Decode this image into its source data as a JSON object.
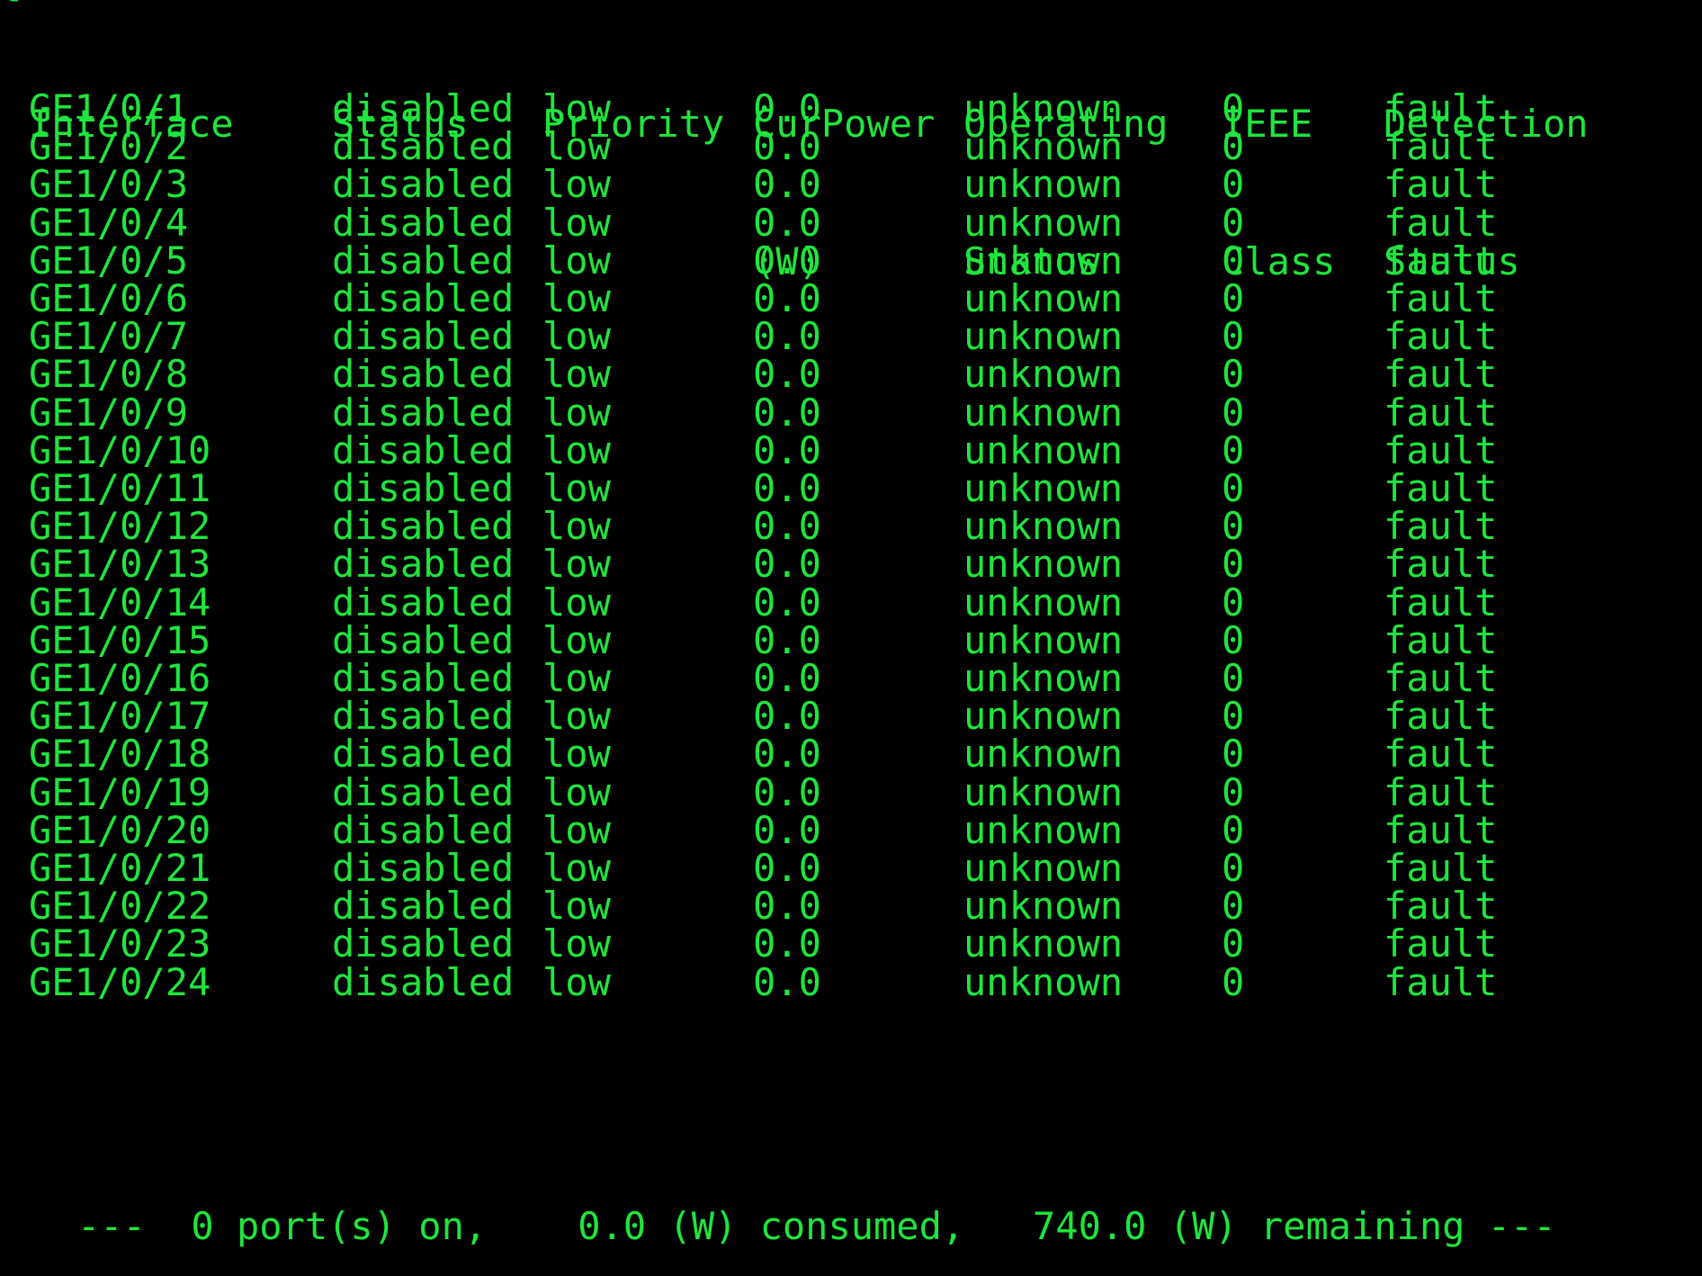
{
  "colors": {
    "background": "#000000",
    "text": "#1ee63c"
  },
  "terminal": {
    "prompt_fragment": "[",
    "headers": {
      "interface": [
        "Interface"
      ],
      "status": [
        "Status"
      ],
      "priority": [
        "Priority"
      ],
      "curpower": [
        "CurPower",
        "(W)"
      ],
      "operating": [
        "Operating",
        "Status"
      ],
      "ieee": [
        "IEEE",
        "Class"
      ],
      "detection": [
        "Detection",
        "Status"
      ]
    },
    "rows": [
      {
        "interface": "GE1/0/1",
        "status": "disabled",
        "priority": "low",
        "curpower": "0.0",
        "operating": "unknown",
        "ieee_class": "0",
        "detection": "fault"
      },
      {
        "interface": "GE1/0/2",
        "status": "disabled",
        "priority": "low",
        "curpower": "0.0",
        "operating": "unknown",
        "ieee_class": "0",
        "detection": "fault"
      },
      {
        "interface": "GE1/0/3",
        "status": "disabled",
        "priority": "low",
        "curpower": "0.0",
        "operating": "unknown",
        "ieee_class": "0",
        "detection": "fault"
      },
      {
        "interface": "GE1/0/4",
        "status": "disabled",
        "priority": "low",
        "curpower": "0.0",
        "operating": "unknown",
        "ieee_class": "0",
        "detection": "fault"
      },
      {
        "interface": "GE1/0/5",
        "status": "disabled",
        "priority": "low",
        "curpower": "0.0",
        "operating": "unknown",
        "ieee_class": "0",
        "detection": "fault"
      },
      {
        "interface": "GE1/0/6",
        "status": "disabled",
        "priority": "low",
        "curpower": "0.0",
        "operating": "unknown",
        "ieee_class": "0",
        "detection": "fault"
      },
      {
        "interface": "GE1/0/7",
        "status": "disabled",
        "priority": "low",
        "curpower": "0.0",
        "operating": "unknown",
        "ieee_class": "0",
        "detection": "fault"
      },
      {
        "interface": "GE1/0/8",
        "status": "disabled",
        "priority": "low",
        "curpower": "0.0",
        "operating": "unknown",
        "ieee_class": "0",
        "detection": "fault"
      },
      {
        "interface": "GE1/0/9",
        "status": "disabled",
        "priority": "low",
        "curpower": "0.0",
        "operating": "unknown",
        "ieee_class": "0",
        "detection": "fault"
      },
      {
        "interface": "GE1/0/10",
        "status": "disabled",
        "priority": "low",
        "curpower": "0.0",
        "operating": "unknown",
        "ieee_class": "0",
        "detection": "fault"
      },
      {
        "interface": "GE1/0/11",
        "status": "disabled",
        "priority": "low",
        "curpower": "0.0",
        "operating": "unknown",
        "ieee_class": "0",
        "detection": "fault"
      },
      {
        "interface": "GE1/0/12",
        "status": "disabled",
        "priority": "low",
        "curpower": "0.0",
        "operating": "unknown",
        "ieee_class": "0",
        "detection": "fault"
      },
      {
        "interface": "GE1/0/13",
        "status": "disabled",
        "priority": "low",
        "curpower": "0.0",
        "operating": "unknown",
        "ieee_class": "0",
        "detection": "fault"
      },
      {
        "interface": "GE1/0/14",
        "status": "disabled",
        "priority": "low",
        "curpower": "0.0",
        "operating": "unknown",
        "ieee_class": "0",
        "detection": "fault"
      },
      {
        "interface": "GE1/0/15",
        "status": "disabled",
        "priority": "low",
        "curpower": "0.0",
        "operating": "unknown",
        "ieee_class": "0",
        "detection": "fault"
      },
      {
        "interface": "GE1/0/16",
        "status": "disabled",
        "priority": "low",
        "curpower": "0.0",
        "operating": "unknown",
        "ieee_class": "0",
        "detection": "fault"
      },
      {
        "interface": "GE1/0/17",
        "status": "disabled",
        "priority": "low",
        "curpower": "0.0",
        "operating": "unknown",
        "ieee_class": "0",
        "detection": "fault"
      },
      {
        "interface": "GE1/0/18",
        "status": "disabled",
        "priority": "low",
        "curpower": "0.0",
        "operating": "unknown",
        "ieee_class": "0",
        "detection": "fault"
      },
      {
        "interface": "GE1/0/19",
        "status": "disabled",
        "priority": "low",
        "curpower": "0.0",
        "operating": "unknown",
        "ieee_class": "0",
        "detection": "fault"
      },
      {
        "interface": "GE1/0/20",
        "status": "disabled",
        "priority": "low",
        "curpower": "0.0",
        "operating": "unknown",
        "ieee_class": "0",
        "detection": "fault"
      },
      {
        "interface": "GE1/0/21",
        "status": "disabled",
        "priority": "low",
        "curpower": "0.0",
        "operating": "unknown",
        "ieee_class": "0",
        "detection": "fault"
      },
      {
        "interface": "GE1/0/22",
        "status": "disabled",
        "priority": "low",
        "curpower": "0.0",
        "operating": "unknown",
        "ieee_class": "0",
        "detection": "fault"
      },
      {
        "interface": "GE1/0/23",
        "status": "disabled",
        "priority": "low",
        "curpower": "0.0",
        "operating": "unknown",
        "ieee_class": "0",
        "detection": "fault"
      },
      {
        "interface": "GE1/0/24",
        "status": "disabled",
        "priority": "low",
        "curpower": "0.0",
        "operating": "unknown",
        "ieee_class": "0",
        "detection": "fault"
      }
    ],
    "summary": "---  0 port(s) on,    0.0 (W) consumed,   740.0 (W) remaining ---"
  }
}
